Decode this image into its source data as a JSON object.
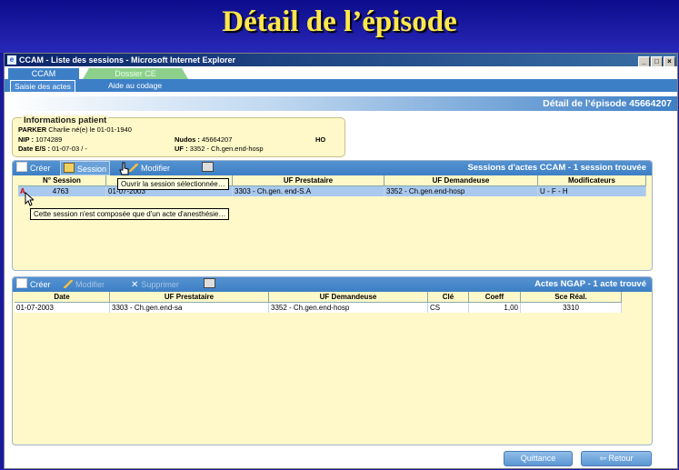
{
  "slide": {
    "title": "Détail de l’épisode"
  },
  "window": {
    "title": "CCAM - Liste des sessions - Microsoft Internet Explorer",
    "buttons": [
      "_",
      "□",
      "×"
    ]
  },
  "tabs": [
    {
      "label": "CCAM"
    },
    {
      "label": "Dossier CE"
    }
  ],
  "subtabs": [
    {
      "label": "Saisie des actes"
    },
    {
      "label": "Aide au codage"
    }
  ],
  "detail_bar": {
    "label": "Détail de l’épisode 45664207"
  },
  "patient": {
    "title": "Informations patient",
    "name_label": "PARKER",
    "name_value": "Charlie né(e) le 01-01-1940",
    "nip_label": "NIP :",
    "nip_value": "1074289",
    "nudos_label": "Nudos :",
    "nudos_value": "45664207",
    "ho_label": "HO",
    "dates_label": "Date E/S :",
    "dates_value": "01-07-03 / -",
    "uf_label": "UF :",
    "uf_value": "3352 - Ch.gen.end-hosp"
  },
  "sessions_panel": {
    "toolbar": {
      "create": "Créer",
      "session": "Session",
      "modify": "Modifier"
    },
    "title": "Sessions d'actes CCAM - 1 session trouvée",
    "columns": [
      "N° Session",
      "",
      "UF Prestataire",
      "UF Demandeuse",
      "Modificateurs"
    ],
    "rows": [
      {
        "marker": "A",
        "session": "4763",
        "date": "01-07-2003",
        "uf_prestataire": "3303 - Ch.gen. end-S.A",
        "uf_demandeuse": "3352 - Ch.gen.end-hosp",
        "modificateurs": "U - F - H"
      }
    ],
    "tooltip_open": "Ouvrir la session sélectionnée…",
    "tooltip_anesth": "Cette session n'est composée que d'un acte d'anesthésie…"
  },
  "ngap_panel": {
    "toolbar": {
      "create": "Créer",
      "modify": "Modifier",
      "delete": "Supprimer"
    },
    "title": "Actes NGAP - 1 acte trouvé",
    "columns": [
      "Date",
      "UF Prestataire",
      "UF Demandeuse",
      "Clé",
      "Coeff",
      "Sce Réal."
    ],
    "rows": [
      {
        "date": "01-07-2003",
        "uf_prestataire": "3303 - Ch.gen.end-sa",
        "uf_demandeuse": "3352 - Ch.gen.end-hosp",
        "cle": "CS",
        "coeff": "1,00",
        "sce": "3310"
      }
    ]
  },
  "buttons": {
    "quittance": "Quittance",
    "retour": "Retour"
  }
}
